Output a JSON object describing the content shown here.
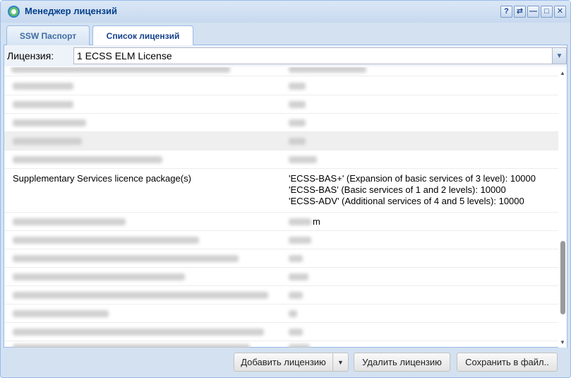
{
  "window": {
    "title": "Менеджер лицензий"
  },
  "titlebar": {
    "help": "?",
    "refresh": "⇄",
    "minimize": "—",
    "maximize": "□",
    "close": "✕"
  },
  "tabs": [
    {
      "label": "SSW Паспорт",
      "active": false
    },
    {
      "label": "Список лицензий",
      "active": true
    }
  ],
  "license_select": {
    "label": "Лицензия:",
    "value": "1 ECSS ELM License"
  },
  "grid": {
    "highlighted_row": {
      "name": "Supplementary Services licence package(s)",
      "values": [
        "'ECSS-BAS+' (Expansion of basic services of 3 level): 10000",
        "'ECSS-BAS' (Basic services of 1 and 2 levels): 10000",
        "'ECSS-ADV' (Additional services of 4 and 5 levels): 10000"
      ]
    },
    "partial_value": "m"
  },
  "buttons": {
    "add": "Добавить лицензию",
    "delete": "Удалить лицензию",
    "save": "Сохранить в файл.."
  },
  "colors": {
    "accent": "#15428b",
    "border": "#99bbe8",
    "frame": "#d3e1f1"
  }
}
